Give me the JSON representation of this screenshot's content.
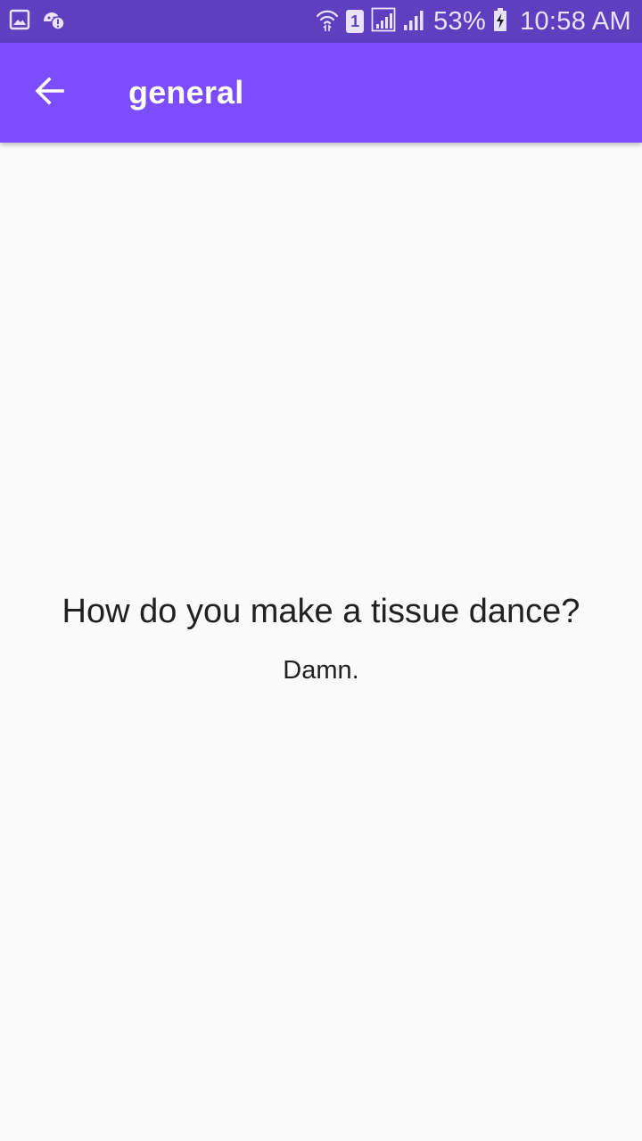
{
  "status_bar": {
    "battery_percent": "53%",
    "time": "10:58 AM",
    "sim_slot": "1",
    "icons": [
      "gallery-icon",
      "android-debug-icon",
      "wifi-icon",
      "sim-icon",
      "signal-icon",
      "signal-icon",
      "battery-charging-icon"
    ],
    "background_color": "#5e3fbf"
  },
  "app_bar": {
    "title": "general",
    "back_icon": "arrow-back-icon",
    "background_color": "#7c4dff"
  },
  "joke": {
    "question": "How do you make a tissue dance?",
    "answer": "Damn."
  }
}
